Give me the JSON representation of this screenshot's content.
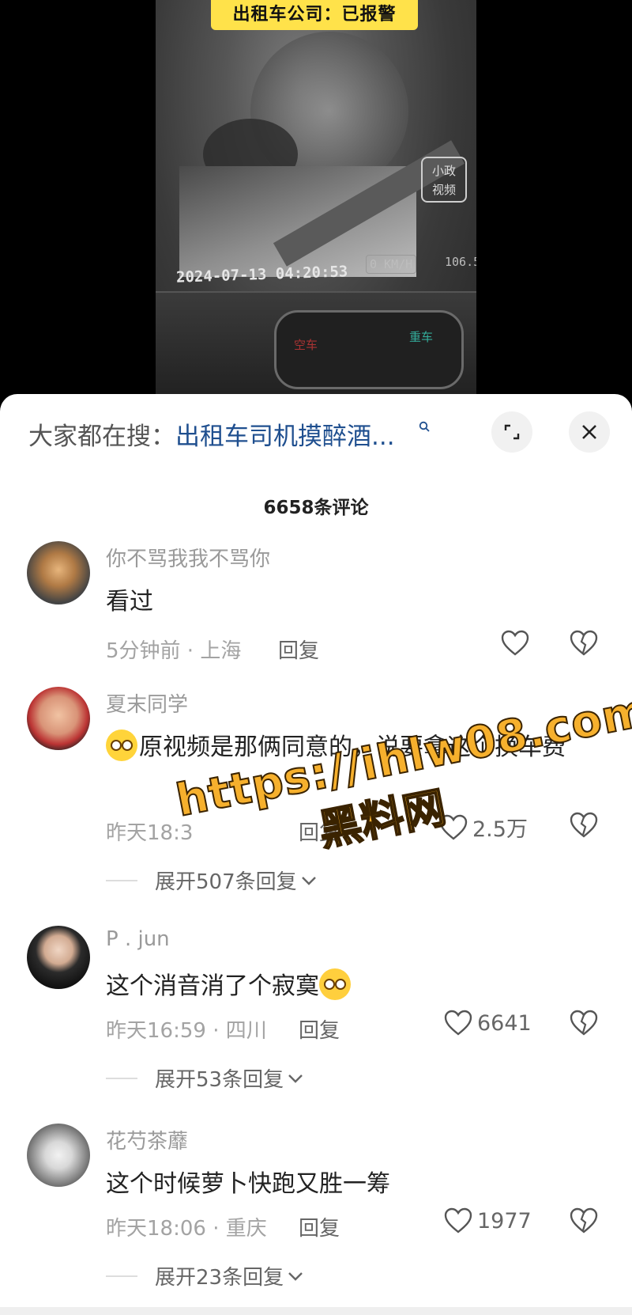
{
  "video": {
    "banner": "出租车公司：已报警",
    "watermark_logo_line1": "小政",
    "watermark_logo_line2": "视频",
    "timestamp": "2024-07-13 04:20:53",
    "speed": "0 KM/H",
    "odometer": "106.5",
    "sign_left": "空车",
    "sign_right": "重车"
  },
  "sheet": {
    "search_prefix": "大家都在搜：",
    "search_term": "出租车司机摸醉酒...",
    "comment_count": "6658条评论"
  },
  "comments": [
    {
      "username": "你不骂我我不骂你",
      "text": "看过",
      "meta": "5分钟前 · 上海",
      "reply_label": "回复",
      "likes": ""
    },
    {
      "username": "夏末同学",
      "text": "原视频是那俩同意的，说要拿这个换车费",
      "meta": "昨天18:3",
      "reply_label": "回复",
      "likes": "2.5万",
      "expand_label": "展开507条回复"
    },
    {
      "username": "P . jun",
      "text": "这个消音消了个寂寞",
      "meta": "昨天16:59 · 四川",
      "reply_label": "回复",
      "likes": "6641",
      "expand_label": "展开53条回复"
    },
    {
      "username": "花芍茶蘼",
      "text": "这个时候萝卜快跑又胜一筹",
      "meta": "昨天18:06 · 重庆",
      "reply_label": "回复",
      "likes": "1977",
      "expand_label": "展开23条回复"
    }
  ],
  "overlay_watermark": {
    "url": "https://ihlw08.com",
    "label": "黑料网"
  },
  "colors": {
    "banner": "#ffe24a",
    "search_link": "#1f4f8f",
    "watermark": "#f6b02d"
  },
  "icons": [
    "search-icon",
    "expand-icon",
    "close-icon",
    "heart-icon",
    "broken-heart-icon",
    "chevron-down-icon"
  ]
}
